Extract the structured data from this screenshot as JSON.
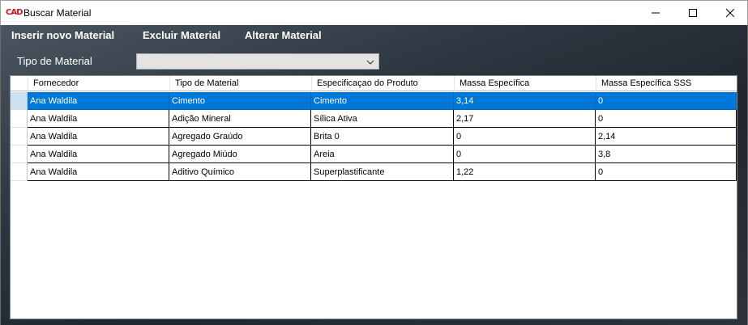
{
  "window": {
    "title": "Buscar Material",
    "logo_text": "CAD"
  },
  "menu": [
    {
      "label": "Inserir novo Material"
    },
    {
      "label": "Excluir Material"
    },
    {
      "label": "Alterar Material"
    }
  ],
  "filter": {
    "label": "Tipo de Material",
    "selected": ""
  },
  "table": {
    "columns": [
      "Fornecedor",
      "Tipo de Material",
      "Especificaçao do Produto",
      "Massa Específica",
      "Massa Específica SSS"
    ],
    "rows": [
      [
        "Ana Waldila",
        "Cimento",
        "Cimento",
        "3,14",
        "0"
      ],
      [
        "Ana Waldila",
        "Adição Mineral",
        "Sílica Ativa",
        "2,17",
        "0"
      ],
      [
        "Ana Waldila",
        "Agregado Graúdo",
        "Brita 0",
        "0",
        "2,14"
      ],
      [
        "Ana Waldila",
        "Agregado Miúdo",
        "Areia",
        "0",
        "3,8"
      ],
      [
        "Ana Waldila",
        "Aditivo Químico",
        "Superplastificante",
        "1,22",
        "0"
      ]
    ],
    "selected_row": 0
  },
  "colors": {
    "selection": "#0078d7",
    "menu_text": "#ffffff"
  }
}
